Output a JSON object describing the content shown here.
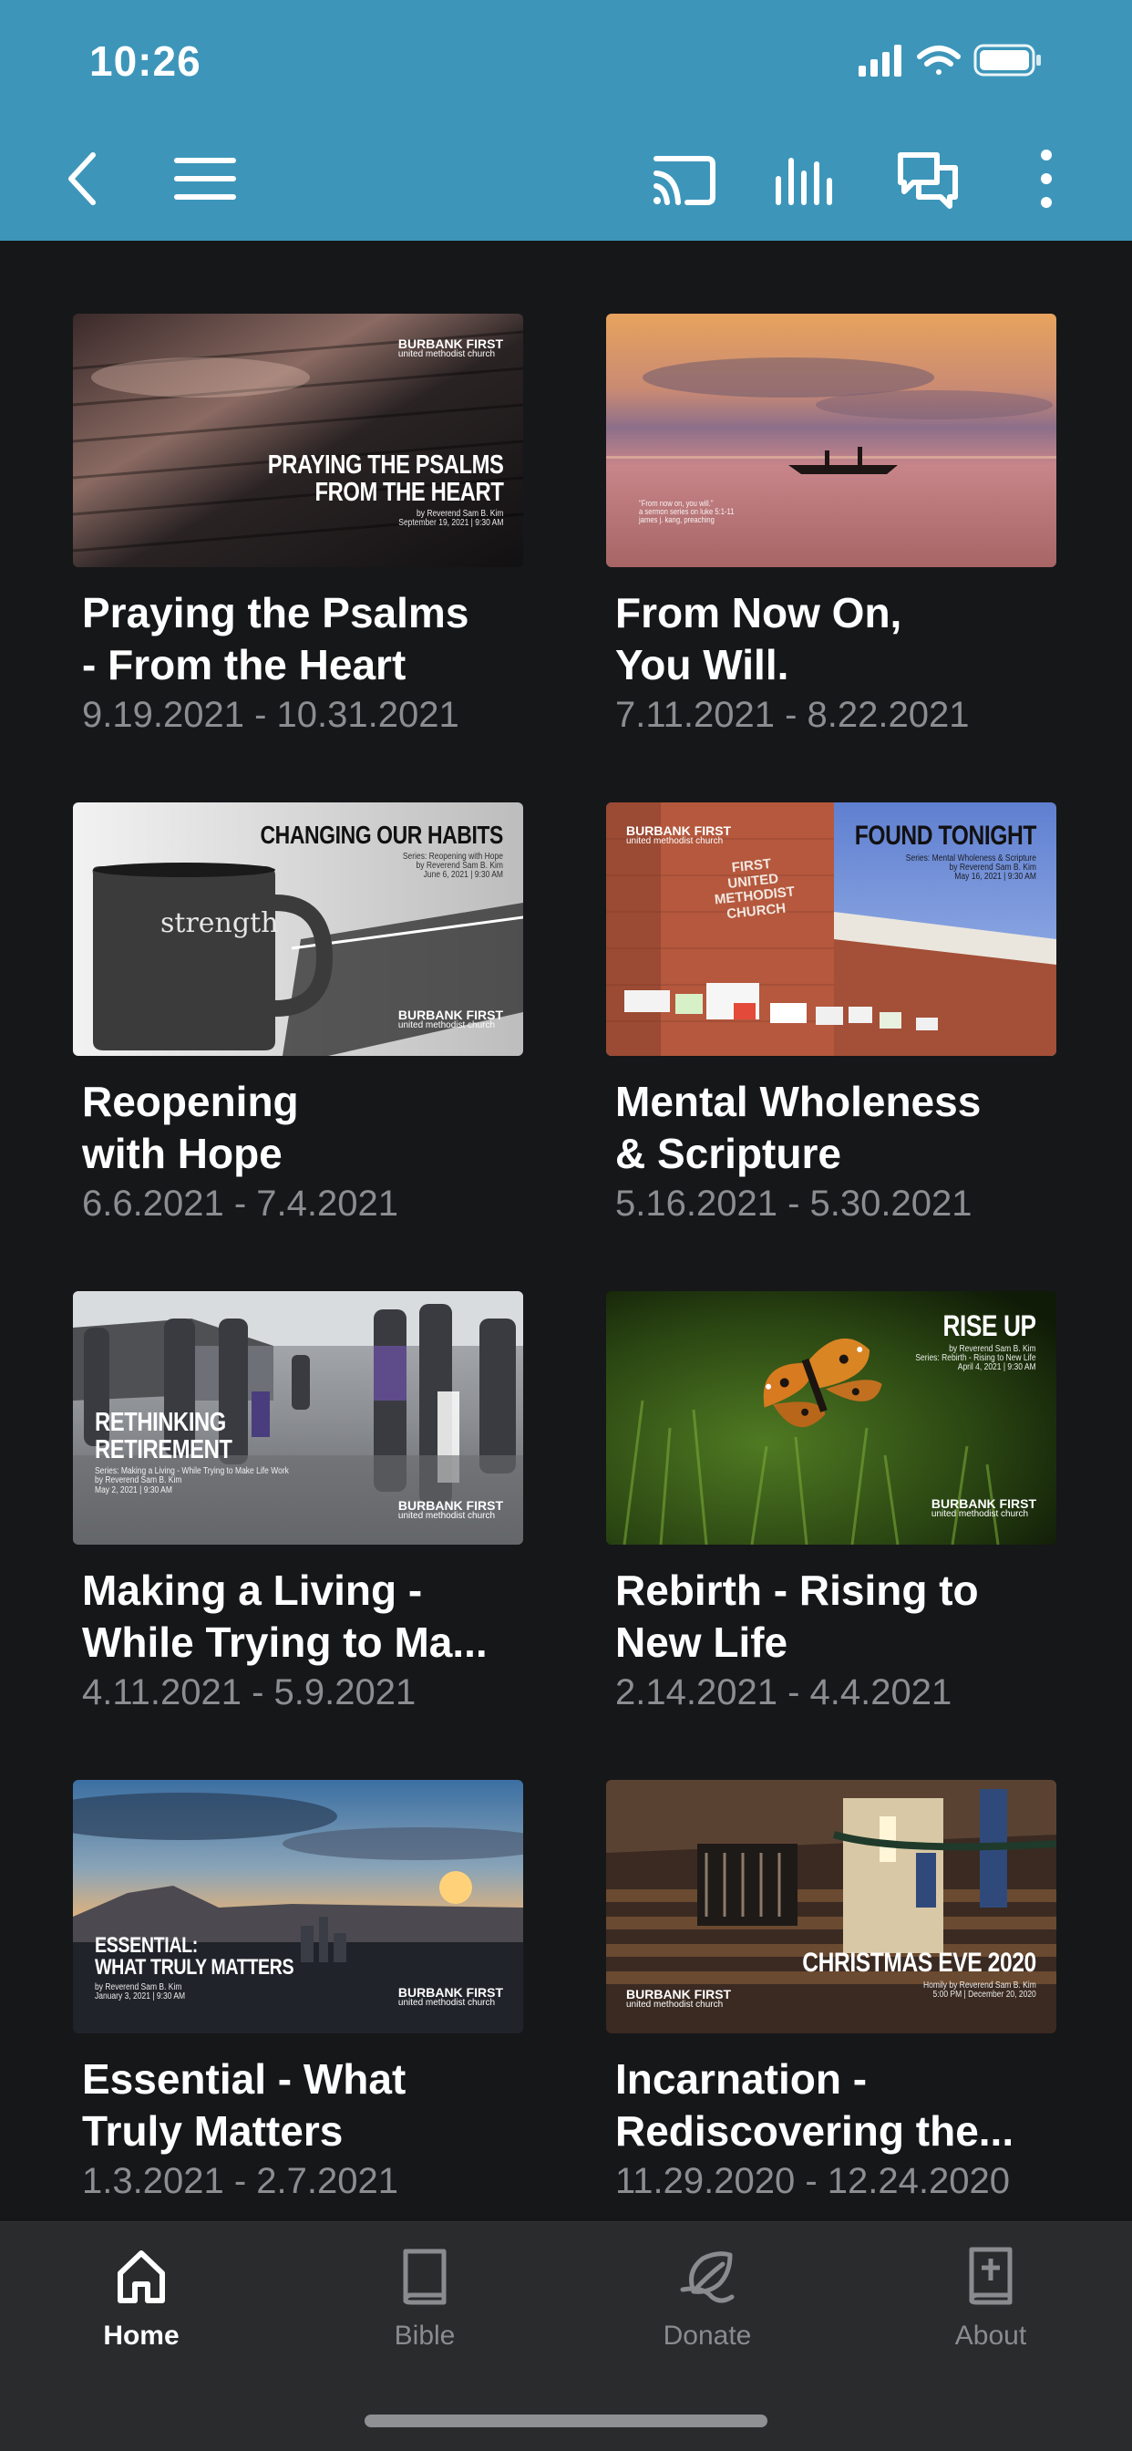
{
  "status_bar": {
    "time": "10:26"
  },
  "header": {
    "icons": [
      "back-chevron-icon",
      "hamburger-menu-icon",
      "cast-icon",
      "audio-bars-icon",
      "chat-icon",
      "more-vertical-icon"
    ]
  },
  "cards": [
    {
      "title": "Praying the Psalms\n- From the Heart",
      "dates": "9.19.2021 - 10.31.2021",
      "thumb_title": "PRAYING THE PSALMS\nFROM THE HEART",
      "thumb_sub": "by Reverend Sam B. Kim\nSeptember 19, 2021  |  9:30 AM",
      "logo": "BURBANK FIRST",
      "logo_sub": "united methodist church"
    },
    {
      "title": "From Now On,\nYou Will.",
      "dates": "7.11.2021 - 8.22.2021",
      "thumb_sub": "\"From now on, you will.\"\na sermon series on luke 5:1-11\njames j. kang, preaching"
    },
    {
      "title": "Reopening\nwith Hope",
      "dates": "6.6.2021 - 7.4.2021",
      "thumb_title": "CHANGING OUR HABITS",
      "thumb_sub": "Series: Reopening with Hope\nby Reverend Sam B. Kim\nJune 6, 2021  |  9:30 AM",
      "mug_text": "strength",
      "logo": "BURBANK FIRST",
      "logo_sub": "united methodist church"
    },
    {
      "title": "Mental Wholeness\n& Scripture",
      "dates": "5.16.2021 - 5.30.2021",
      "thumb_title": "FOUND TONIGHT",
      "thumb_sub": "Series: Mental Wholeness & Scripture\nby Reverend Sam B. Kim\nMay 16, 2021  |  9:30 AM",
      "tower_text": "FIRST\nUNITED\nMETHODIST\nCHURCH",
      "logo": "BURBANK FIRST",
      "logo_sub": "united methodist church"
    },
    {
      "title": "Making a Living -\nWhile Trying to Ma...",
      "dates": "4.11.2021 - 5.9.2021",
      "thumb_title": "RETHINKING\nRETIREMENT",
      "thumb_sub": "Series: Making a Living - While Trying to Make Life Work\nby Reverend Sam B. Kim\nMay 2, 2021  |  9:30 AM",
      "logo": "BURBANK FIRST",
      "logo_sub": "united methodist church"
    },
    {
      "title": "Rebirth - Rising to\nNew Life",
      "dates": "2.14.2021 - 4.4.2021",
      "thumb_title": "RISE UP",
      "thumb_sub": "by Reverend Sam B. Kim\nSeries: Rebirth - Rising to New Life\nApril 4, 2021  |  9:30 AM",
      "logo": "BURBANK FIRST",
      "logo_sub": "united methodist church"
    },
    {
      "title": "Essential - What\nTruly Matters",
      "dates": "1.3.2021 - 2.7.2021",
      "thumb_title": "ESSENTIAL:\nWHAT TRULY MATTERS",
      "thumb_sub": "by Reverend Sam B. Kim\nJanuary 3, 2021  |  9:30 AM",
      "logo": "BURBANK FIRST",
      "logo_sub": "united methodist church"
    },
    {
      "title": "Incarnation -\nRediscovering the...",
      "dates": "11.29.2020 - 12.24.2020",
      "thumb_title": "CHRISTMAS EVE 2020",
      "thumb_sub": "Homily by Reverend Sam B. Kim\n5:00 PM  |  December 20, 2020",
      "logo": "BURBANK FIRST",
      "logo_sub": "united methodist church"
    }
  ],
  "tabs": [
    {
      "label": "Home",
      "icon": "home-icon",
      "active": true
    },
    {
      "label": "Bible",
      "icon": "book-icon",
      "active": false
    },
    {
      "label": "Donate",
      "icon": "donate-leaf-icon",
      "active": false
    },
    {
      "label": "About",
      "icon": "about-bible-plus-icon",
      "active": false
    }
  ],
  "colors": {
    "header_bg": "#3d96ba",
    "page_bg": "#161719",
    "tabbar_bg": "#2a2b2d",
    "date_text": "#8c8d90",
    "inactive_tab": "#8a8b8e"
  }
}
